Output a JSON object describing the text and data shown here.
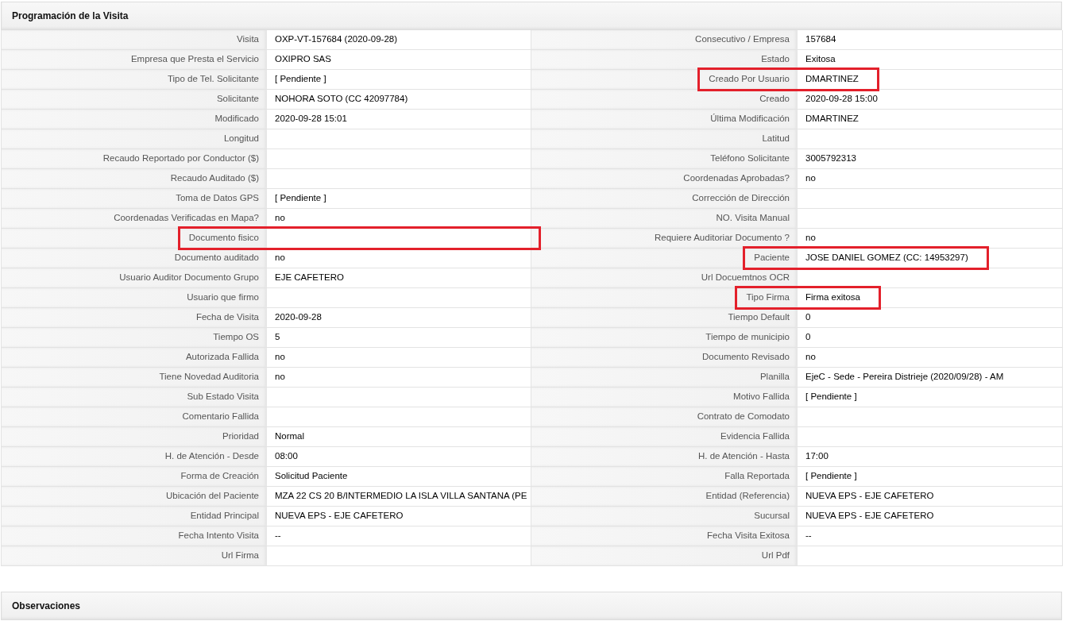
{
  "sections": [
    {
      "title": "Programación de la Visita"
    },
    {
      "title": "Observaciones"
    }
  ],
  "rows": [
    {
      "left": {
        "label": "Visita",
        "value": "OXP-VT-157684 (2020-09-28)",
        "highlighted": false
      },
      "right": {
        "label": "Consecutivo / Empresa",
        "value": "157684",
        "highlighted": false
      }
    },
    {
      "left": {
        "label": "Empresa que Presta el Servicio",
        "value": "OXIPRO SAS",
        "highlighted": false
      },
      "right": {
        "label": "Estado",
        "value": "Exitosa",
        "highlighted": false
      }
    },
    {
      "left": {
        "label": "Tipo de Tel. Solicitante",
        "value": "[ Pendiente ]",
        "highlighted": false
      },
      "right": {
        "label": "Creado Por Usuario",
        "value": "DMARTINEZ",
        "highlighted": true
      }
    },
    {
      "left": {
        "label": "Solicitante",
        "value": "NOHORA SOTO (CC 42097784)",
        "highlighted": false
      },
      "right": {
        "label": "Creado",
        "value": "2020-09-28 15:00",
        "highlighted": false
      }
    },
    {
      "left": {
        "label": "Modificado",
        "value": "2020-09-28 15:01",
        "highlighted": false
      },
      "right": {
        "label": "Última Modificación",
        "value": "DMARTINEZ",
        "highlighted": false
      }
    },
    {
      "left": {
        "label": "Longitud",
        "highlighted": false
      },
      "right": {
        "label": "Latitud",
        "highlighted": false
      }
    },
    {
      "left": {
        "label": "Recaudo Reportado por Conductor ($)",
        "highlighted": false
      },
      "right": {
        "label": "Teléfono Solicitante",
        "value": "3005792313",
        "highlighted": false
      }
    },
    {
      "left": {
        "label": "Recaudo Auditado ($)",
        "highlighted": false
      },
      "right": {
        "label": "Coordenadas Aprobadas?",
        "value": "no",
        "highlighted": false
      }
    },
    {
      "left": {
        "label": "Toma de Datos GPS",
        "value": "[ Pendiente ]",
        "highlighted": false
      },
      "right": {
        "label": "Corrección de Dirección",
        "highlighted": false
      }
    },
    {
      "left": {
        "label": "Coordenadas Verificadas en Mapa?",
        "value": "no",
        "highlighted": false
      },
      "right": {
        "label": "NO. Visita Manual",
        "highlighted": false
      }
    },
    {
      "left": {
        "label": "Documento fisico",
        "highlighted": true
      },
      "right": {
        "label": "Requiere Auditoriar Documento ?",
        "value": "no",
        "highlighted": false
      }
    },
    {
      "left": {
        "label": "Documento auditado",
        "value": "no",
        "highlighted": false
      },
      "right": {
        "label": "Paciente",
        "value": "JOSE DANIEL GOMEZ (CC: 14953297)",
        "highlighted": true
      }
    },
    {
      "left": {
        "label": "Usuario Auditor Documento Grupo",
        "value": "EJE CAFETERO",
        "highlighted": false
      },
      "right": {
        "label": "Url Docuemtnos OCR",
        "highlighted": false
      }
    },
    {
      "left": {
        "label": "Usuario que firmo",
        "highlighted": false
      },
      "right": {
        "label": "Tipo Firma",
        "value": "Firma exitosa",
        "highlighted": true
      }
    },
    {
      "left": {
        "label": "Fecha de Visita",
        "value": "2020-09-28",
        "highlighted": false
      },
      "right": {
        "label": "Tiempo Default",
        "value": "0",
        "highlighted": false
      }
    },
    {
      "left": {
        "label": "Tiempo OS",
        "value": "5",
        "highlighted": false
      },
      "right": {
        "label": "Tiempo de municipio",
        "value": "0",
        "highlighted": false
      }
    },
    {
      "left": {
        "label": "Autorizada Fallida",
        "value": "no",
        "highlighted": false
      },
      "right": {
        "label": "Documento Revisado",
        "value": "no",
        "highlighted": false
      }
    },
    {
      "left": {
        "label": "Tiene Novedad Auditoria",
        "value": "no",
        "highlighted": false
      },
      "right": {
        "label": "Planilla",
        "value": "EjeC - Sede - Pereira Distrieje (2020/09/28) - AM",
        "highlighted": false
      }
    },
    {
      "left": {
        "label": "Sub Estado Visita",
        "highlighted": false
      },
      "right": {
        "label": "Motivo Fallida",
        "value": "[ Pendiente ]",
        "highlighted": false
      }
    },
    {
      "left": {
        "label": "Comentario Fallida",
        "highlighted": false
      },
      "right": {
        "label": "Contrato de Comodato",
        "highlighted": false
      }
    },
    {
      "left": {
        "label": "Prioridad",
        "value": "Normal",
        "highlighted": false
      },
      "right": {
        "label": "Evidencia Fallida",
        "highlighted": false
      }
    },
    {
      "left": {
        "label": "H. de Atención - Desde",
        "value": "08:00",
        "highlighted": false
      },
      "right": {
        "label": "H. de Atención - Hasta",
        "value": "17:00",
        "highlighted": false
      }
    },
    {
      "left": {
        "label": "Forma de Creación",
        "value": "Solicitud Paciente",
        "highlighted": false
      },
      "right": {
        "label": "Falla Reportada",
        "value": "[ Pendiente ]",
        "highlighted": false
      }
    },
    {
      "left": {
        "label": "Ubicación del Paciente",
        "value": "MZA 22 CS 20 B/INTERMEDIO LA ISLA VILLA SANTANA (PE",
        "highlighted": false
      },
      "right": {
        "label": "Entidad (Referencia)",
        "value": "NUEVA EPS - EJE CAFETERO",
        "highlighted": false
      }
    },
    {
      "left": {
        "label": "Entidad Principal",
        "value": "NUEVA EPS - EJE CAFETERO",
        "highlighted": false
      },
      "right": {
        "label": "Sucursal",
        "value": "NUEVA EPS - EJE CAFETERO",
        "highlighted": false
      }
    },
    {
      "left": {
        "label": "Fecha Intento Visita",
        "value": "--",
        "highlighted": false
      },
      "right": {
        "label": "Fecha Visita Exitosa",
        "value": "--",
        "highlighted": false
      }
    },
    {
      "left": {
        "label": "Url Firma",
        "highlighted": false
      },
      "right": {
        "label": "Url Pdf",
        "highlighted": false
      }
    }
  ]
}
